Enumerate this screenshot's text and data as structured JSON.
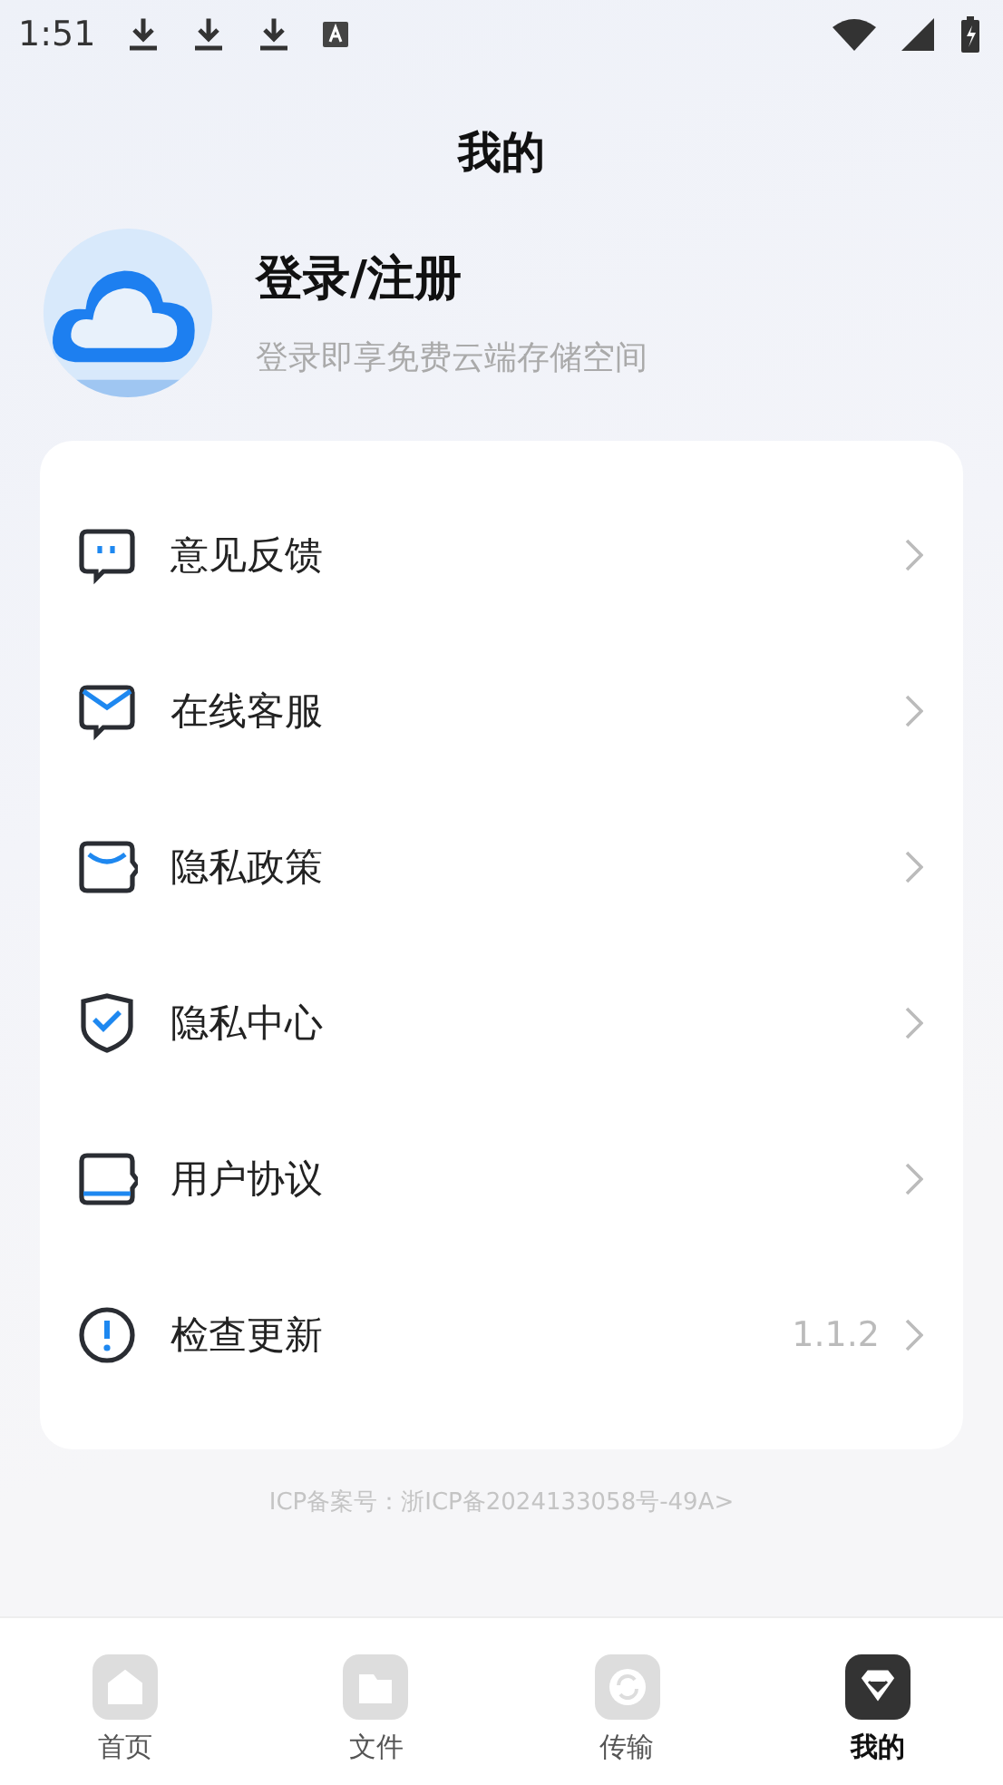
{
  "status_bar": {
    "time": "1:51"
  },
  "title": "我的",
  "profile": {
    "name": "登录/注册",
    "subtitle": "登录即享免费云端存储空间"
  },
  "menu": [
    {
      "kind": "feedback",
      "label": "意见反馈"
    },
    {
      "kind": "service",
      "label": "在线客服"
    },
    {
      "kind": "policy",
      "label": "隐私政策"
    },
    {
      "kind": "shield",
      "label": "隐私中心"
    },
    {
      "kind": "agreement",
      "label": "用户协议"
    },
    {
      "kind": "update",
      "label": "检查更新",
      "value": "1.1.2"
    }
  ],
  "icp": "ICP备案号：浙ICP备2024133058号-49A>",
  "tabs": [
    {
      "kind": "home",
      "label": "首页",
      "selected": false
    },
    {
      "kind": "files",
      "label": "文件",
      "selected": false
    },
    {
      "kind": "transfer",
      "label": "传输",
      "selected": false
    },
    {
      "kind": "mine",
      "label": "我的",
      "selected": true
    }
  ]
}
